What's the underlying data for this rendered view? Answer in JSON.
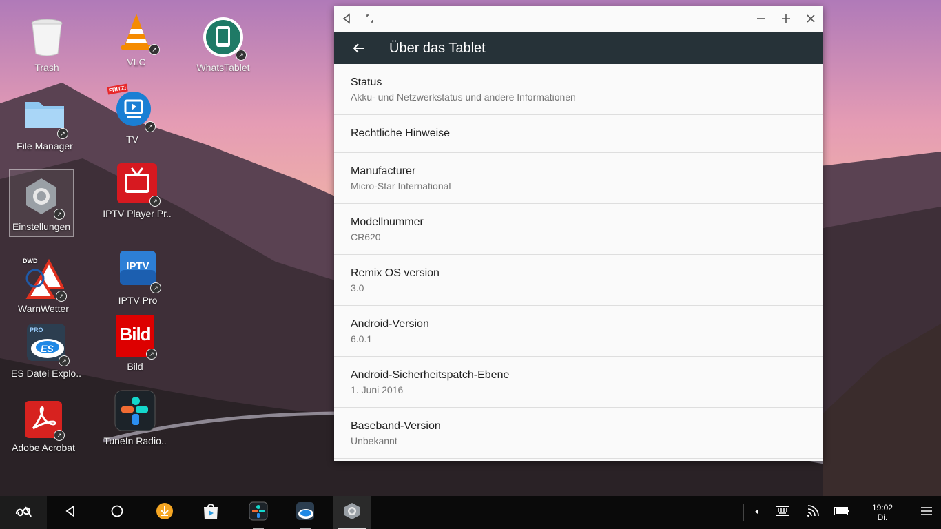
{
  "desktop": {
    "icons": [
      {
        "label": "Trash"
      },
      {
        "label": "VLC"
      },
      {
        "label": "WhatsTablet"
      },
      {
        "label": "File Manager"
      },
      {
        "label": "TV"
      },
      {
        "label": "Einstellungen"
      },
      {
        "label": "IPTV Player Pr.."
      },
      {
        "label": "WarnWetter"
      },
      {
        "label": "IPTV Pro"
      },
      {
        "label": "ES Datei Explo.."
      },
      {
        "label": "Bild"
      },
      {
        "label": "Adobe Acrobat"
      },
      {
        "label": "TuneIn Radio.."
      }
    ],
    "icon_text": {
      "iptv": "IPTV",
      "bild": "Bild",
      "dwd": "DWD",
      "pro": "PRO",
      "es": "ES",
      "fritz": "FRITZ!"
    }
  },
  "window": {
    "title": "Über das Tablet",
    "items": [
      {
        "title": "Status",
        "subtitle": "Akku- und Netzwerkstatus und andere Informationen"
      },
      {
        "title": "Rechtliche Hinweise",
        "subtitle": ""
      },
      {
        "title": "Manufacturer",
        "subtitle": "Micro-Star International"
      },
      {
        "title": "Modellnummer",
        "subtitle": "CR620"
      },
      {
        "title": "Remix OS version",
        "subtitle": "3.0"
      },
      {
        "title": "Android-Version",
        "subtitle": "6.0.1"
      },
      {
        "title": "Android-Sicherheitspatch-Ebene",
        "subtitle": "1. Juni 2016"
      },
      {
        "title": "Baseband-Version",
        "subtitle": "Unbekannt"
      }
    ]
  },
  "taskbar": {
    "time": "19:02",
    "day": "Di."
  },
  "colors": {
    "appbar": "#263238",
    "accent_orange": "#f5a623"
  }
}
